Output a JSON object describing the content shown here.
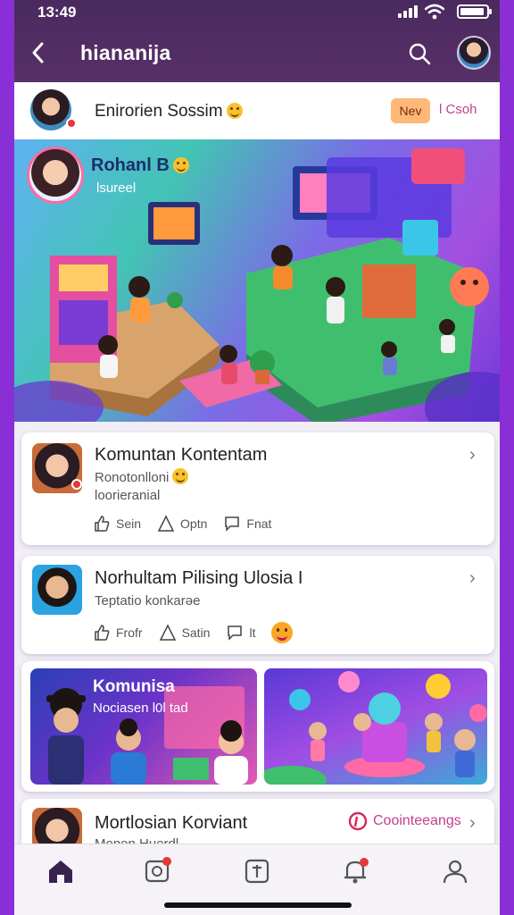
{
  "status": {
    "time": "13:49"
  },
  "header": {
    "title": "hiananija"
  },
  "post": {
    "name": "Enirorien Sossim",
    "new_label": "Nev",
    "join_label": "l Csoh"
  },
  "hero": {
    "title": "Rohanl B",
    "subtitle": "lsureel"
  },
  "cards": [
    {
      "title": "Komuntan Kontentam",
      "sub1": "Ronotonlloni",
      "sub2": "loorieranial",
      "actions": [
        "Sein",
        "Optn",
        "Fnat"
      ]
    },
    {
      "title": "Norhultam Pilising Ulosia I",
      "sub1": "Teptatio konkarəe",
      "actions": [
        "Frofr",
        "Satin",
        "lt"
      ]
    }
  ],
  "gallery": {
    "title": "Komunisa",
    "subtitle": "Nociasen l0l tad"
  },
  "card3": {
    "title": "Mortlosian Korviant",
    "link": "Coointeeangs",
    "sub": "Monon Huerdl"
  },
  "colors": {
    "header": "#4a2a5e",
    "accent": "#c2408c",
    "frame": "#8a2fd6"
  },
  "nav": [
    "home-icon",
    "notifications-box-icon",
    "add-icon",
    "alerts-icon",
    "profile-icon"
  ]
}
